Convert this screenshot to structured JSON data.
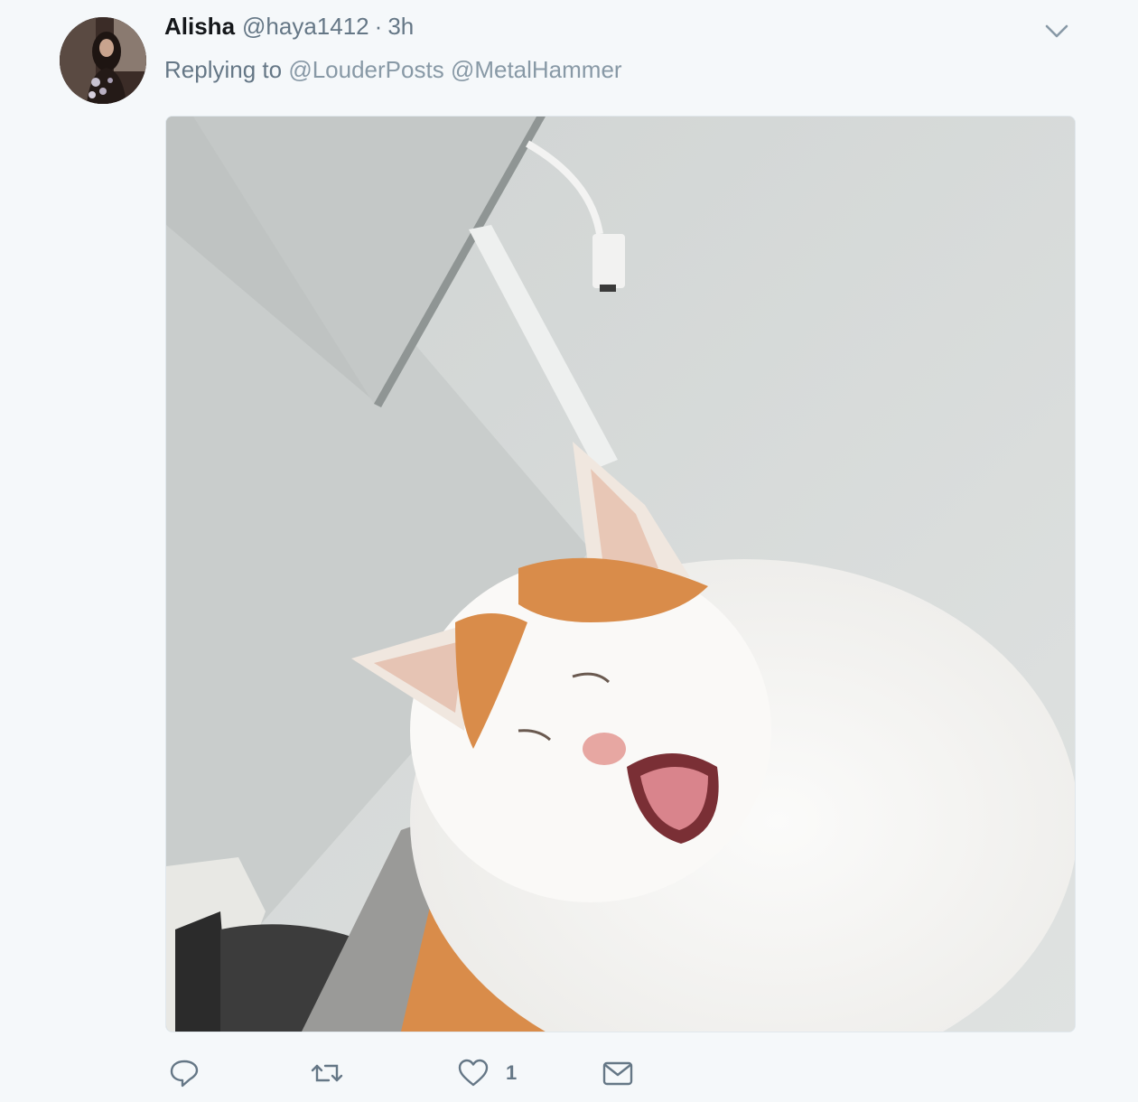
{
  "tweet": {
    "author_name": "Alisha",
    "handle": "@haya1412",
    "separator": "·",
    "time": "3h",
    "replying_prefix": "Replying to",
    "mentions": [
      "@LouderPosts",
      "@MetalHammer"
    ]
  },
  "actions": {
    "reply_icon": "reply-icon",
    "retweet_icon": "retweet-icon",
    "like_icon": "heart-icon",
    "like_count": "1",
    "dm_icon": "envelope-icon"
  },
  "colors": {
    "text_primary": "#14171a",
    "text_secondary": "#657786",
    "mention": "#8899a6",
    "background": "#f5f8fa"
  }
}
